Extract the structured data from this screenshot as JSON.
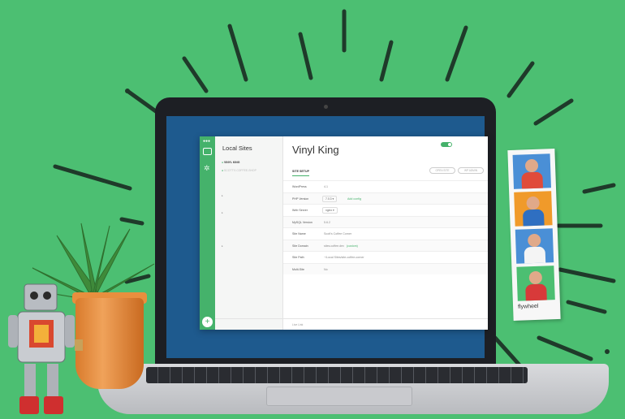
{
  "app": {
    "sidebar": {
      "title": "Local Sites",
      "sites": [
        {
          "label": "VINYL KING",
          "state": "active"
        },
        {
          "label": "SCOTT'S COFFEE-SHOP",
          "state": "dot"
        },
        {
          "label": "",
          "state": ""
        },
        {
          "label": "",
          "state": ""
        },
        {
          "label": "",
          "state": "grp"
        },
        {
          "label": "",
          "state": ""
        },
        {
          "label": "",
          "state": "grp"
        },
        {
          "label": "",
          "state": ""
        },
        {
          "label": "",
          "state": ""
        },
        {
          "label": "",
          "state": ""
        },
        {
          "label": "",
          "state": "grp"
        },
        {
          "label": "",
          "state": ""
        }
      ],
      "footer_left": "",
      "footer_right": ""
    },
    "site": {
      "title": "Vinyl King",
      "subtitle": "",
      "toggle_label": "",
      "stop_label": "",
      "open_site_label": "OPEN SITE",
      "admin_label": "WP ADMIN",
      "tabs": [
        "SITE SETUP",
        "",
        "",
        "",
        ""
      ],
      "rows": [
        {
          "key": "WordPress",
          "value": "4.1"
        },
        {
          "key": "PHP Version",
          "value": "7.0.3",
          "extra": "Add config"
        },
        {
          "key": "Web Server",
          "value": "nginx"
        },
        {
          "key": "MySQL Version",
          "value": "5.6.2"
        },
        {
          "key": "Site Name",
          "value": "Scott's Coffee Corner"
        },
        {
          "key": "Site Domain",
          "value": "sites.coffee.dev",
          "extra": "(custom)"
        },
        {
          "key": "Site Path",
          "value": "~/Local Sites/site-coffee-corner"
        },
        {
          "key": "Multi-Site",
          "value": "No"
        }
      ],
      "footer": "Live Link",
      "footer_link": ""
    }
  },
  "photo_strip": {
    "brand": "flywheel"
  },
  "colors": {
    "background": "#4cbf72",
    "accent": "#45b26b",
    "screen": "#1e5a8e"
  }
}
